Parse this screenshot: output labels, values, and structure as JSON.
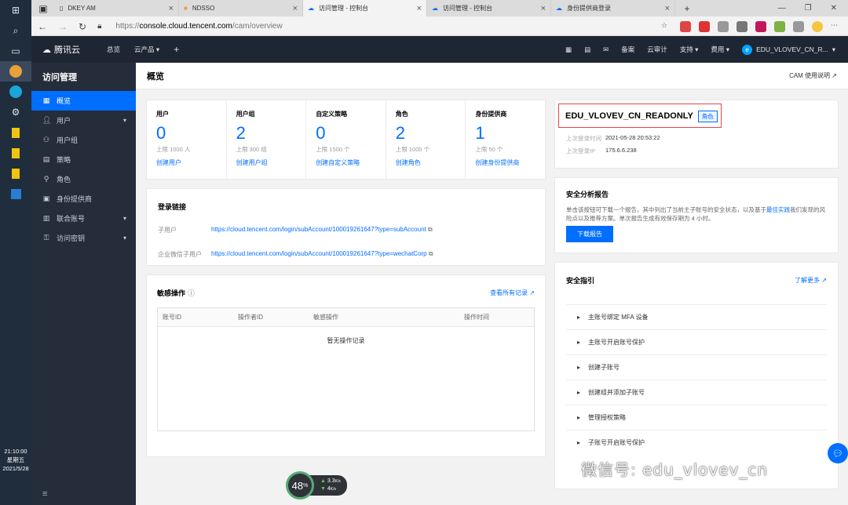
{
  "browser": {
    "tabs": [
      {
        "title": "DKEY AM",
        "active": false
      },
      {
        "title": "NDSSO",
        "active": false
      },
      {
        "title": "访问管理 - 控制台",
        "active": true
      },
      {
        "title": "访问管理 - 控制台",
        "active": false
      },
      {
        "title": "身份提供商登录",
        "active": false
      }
    ],
    "url_scheme": "https://",
    "url_domain": "console.cloud.tencent.com",
    "url_path": "/cam/overview"
  },
  "topnav": {
    "brand": "腾讯云",
    "overview": "总览",
    "products": "云产品",
    "add": "+",
    "record": "备案",
    "audit": "云审计",
    "support": "支持",
    "fees": "费用",
    "user": "EDU_VLOVEV_CN_R..."
  },
  "sidebar": {
    "title": "访问管理",
    "items": [
      {
        "label": "概览",
        "icon": "grid-icon"
      },
      {
        "label": "用户",
        "icon": "user-icon"
      },
      {
        "label": "用户组",
        "icon": "group-icon"
      },
      {
        "label": "策略",
        "icon": "policy-icon"
      },
      {
        "label": "角色",
        "icon": "role-icon"
      },
      {
        "label": "身份提供商",
        "icon": "idp-icon"
      },
      {
        "label": "联合账号",
        "icon": "federation-icon"
      },
      {
        "label": "访问密钥",
        "icon": "key-icon"
      }
    ]
  },
  "page": {
    "title": "概览",
    "help": "CAM 使用说明"
  },
  "stats": [
    {
      "label": "用户",
      "value": "0",
      "limit": "上限 1000 人",
      "link": "创建用户"
    },
    {
      "label": "用户组",
      "value": "2",
      "limit": "上限 300 组",
      "link": "创建用户组"
    },
    {
      "label": "自定义策略",
      "value": "0",
      "limit": "上限 1500 个",
      "link": "创建自定义策略"
    },
    {
      "label": "角色",
      "value": "2",
      "limit": "上限 1000 个",
      "link": "创建角色"
    },
    {
      "label": "身份提供商",
      "value": "1",
      "limit": "上限 50 个",
      "link": "创建身份提供商"
    }
  ],
  "login": {
    "title": "登录链接",
    "sub_label": "子用户",
    "sub_url": "https://cloud.tencent.com/login/subAccount/100019261647?type=subAccount",
    "wx_label": "企业微信子用户",
    "wx_url": "https://cloud.tencent.com/login/subAccount/100019261647?type=wechatCorp"
  },
  "sensitive": {
    "title": "敏感操作",
    "view_all": "查看所有记录",
    "cols": [
      "账号ID",
      "操作者ID",
      "敏感操作",
      "操作时间"
    ],
    "empty": "暂无操作记录"
  },
  "account": {
    "name": "EDU_VLOVEV_CN_READONLY",
    "badge": "角色",
    "last_time_label": "上次登录时间",
    "last_time": "2021-05-28 20:53:22",
    "last_ip_label": "上次登录IP",
    "last_ip": "175.6.6.238"
  },
  "report": {
    "title": "安全分析报告",
    "desc_a": "单击该按钮可下载一个报告，其中列出了当前主子账号的安全状态，以及基于",
    "desc_link": "最佳实践",
    "desc_b": "我们发现的风险点以及推荐方案。单次报告生成有效保存期为 4 小时。",
    "button": "下载报告"
  },
  "guide": {
    "title": "安全指引",
    "more": "了解更多",
    "items": [
      "主账号绑定 MFA 设备",
      "主账号开启账号保护",
      "创建子账号",
      "创建组并添加子账号",
      "管理授权策略",
      "子账号开启账号保护"
    ]
  },
  "overlay": {
    "meter": "48",
    "meter_unit": "%",
    "up": "3.3",
    "down": "4",
    "speed_unit": "K/s",
    "watermark": "微信号: edu_vlovev_cn"
  },
  "clock": {
    "time": "21:10:00",
    "day": "星期五",
    "date": "2021/5/28"
  }
}
